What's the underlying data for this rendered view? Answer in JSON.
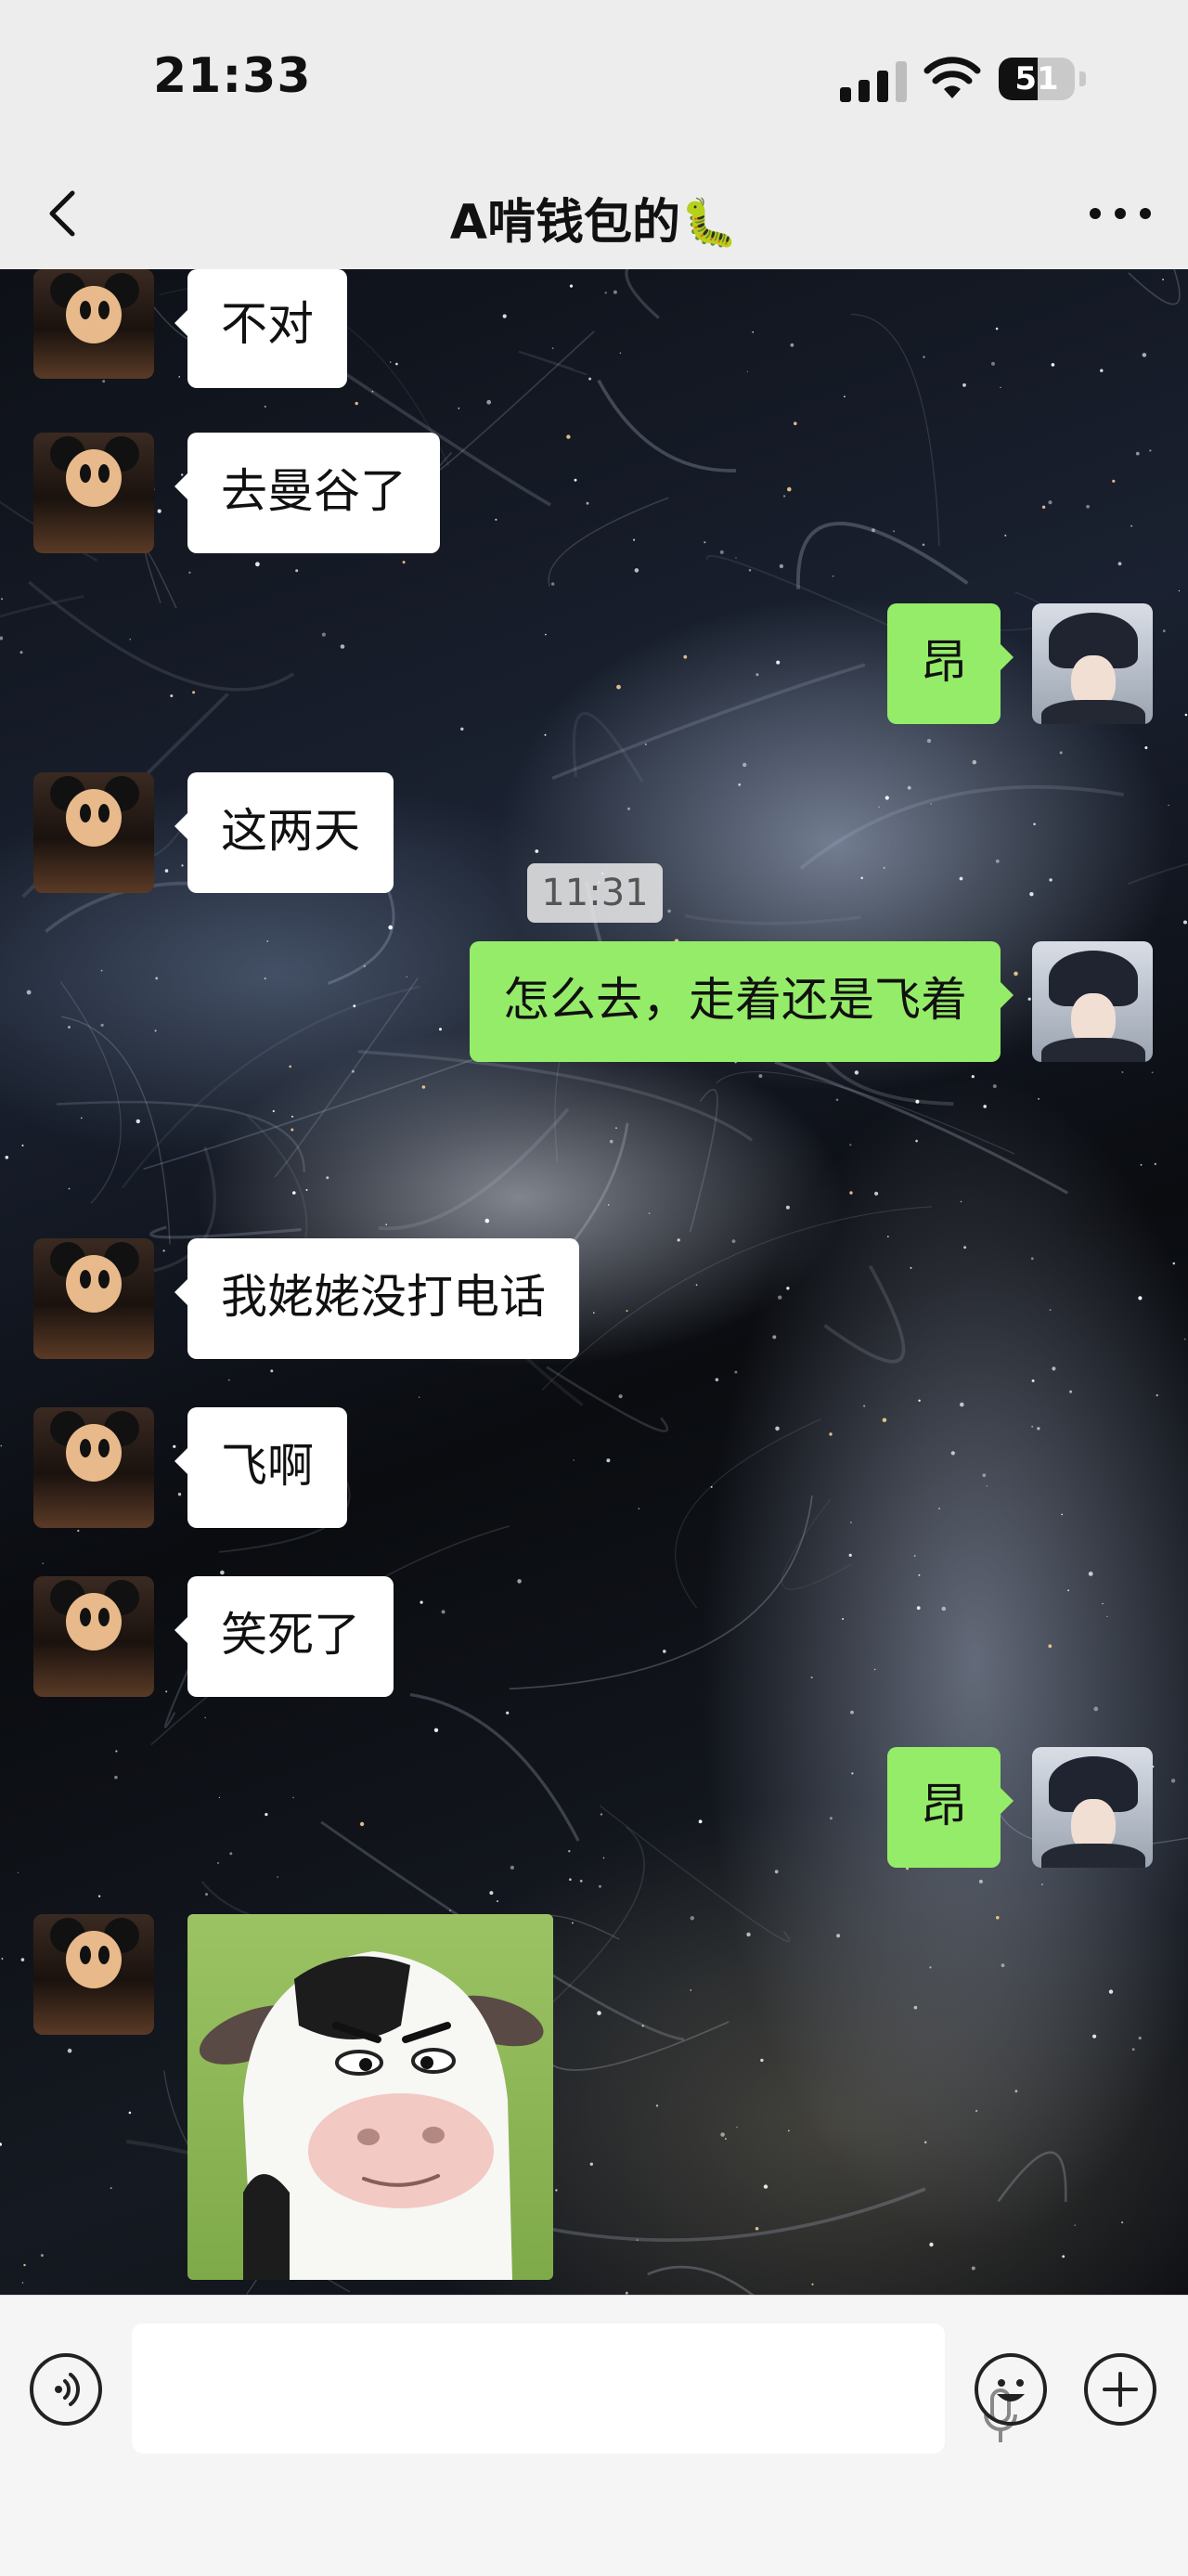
{
  "status_bar": {
    "time": "21:33",
    "battery": "51",
    "battery_level_percent": 51
  },
  "header": {
    "title": "A啃钱包的",
    "title_emoji_icon": "caterpillar-icon"
  },
  "messages": [
    {
      "side": "left",
      "text": "不对"
    },
    {
      "side": "left",
      "text": "去曼谷了"
    },
    {
      "side": "right",
      "text": "昂"
    },
    {
      "side": "left",
      "text": "这两天"
    },
    {
      "side": "right",
      "text": "怎么去，走着还是飞着"
    },
    {
      "type": "time",
      "text": "11:31"
    },
    {
      "side": "left",
      "text": "我姥姥没打电话"
    },
    {
      "side": "left",
      "text": "飞啊"
    },
    {
      "side": "left",
      "text": "笑死了"
    },
    {
      "side": "right",
      "text": "昂"
    },
    {
      "side": "left",
      "type": "sticker",
      "sticker_icon": "cow-sticker-icon"
    }
  ],
  "input_bar": {
    "voice_icon": "voice-toggle-icon",
    "mic_icon": "microphone-icon",
    "emoji_icon": "emoji-icon",
    "plus_icon": "plus-icon"
  }
}
